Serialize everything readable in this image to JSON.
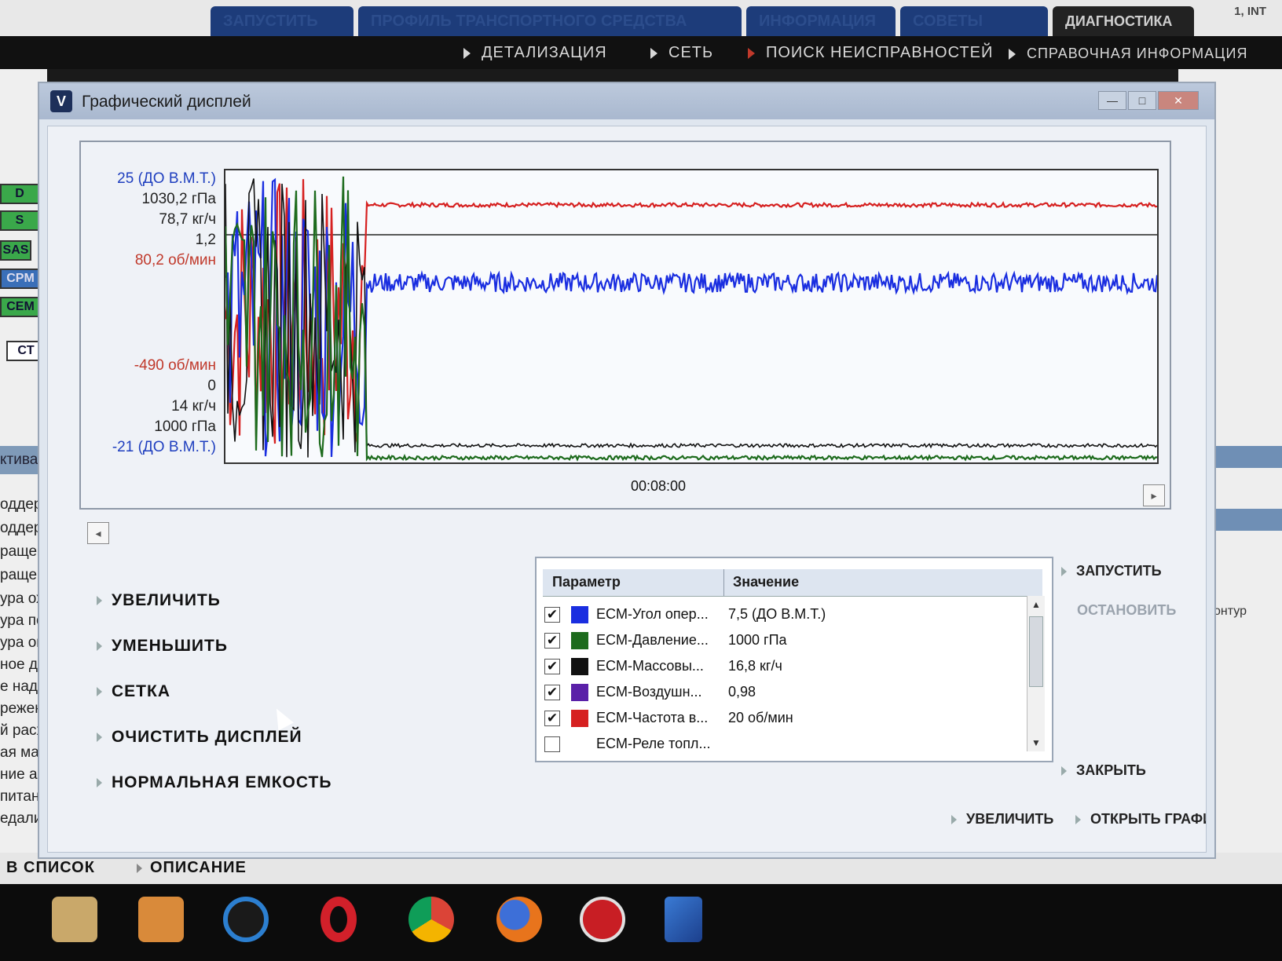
{
  "top_tabs": [
    {
      "label": "ЗАПУСТИТЬ"
    },
    {
      "label": "ПРОФИЛЬ ТРАНСПОРТНОГО СРЕДСТВА"
    },
    {
      "label": "ИНФОРМАЦИЯ"
    },
    {
      "label": "СОВЕТЫ"
    },
    {
      "label": "ДИАГНОСТИКА"
    }
  ],
  "top_corner": "1, INT",
  "subnav": [
    {
      "label": "ДЕТАЛИЗАЦИЯ"
    },
    {
      "label": "СЕТЬ"
    },
    {
      "label": "ПОИСК НЕИСПРАВНОСТЕЙ"
    },
    {
      "label": "СПРАВОЧНАЯ ИНФОРМАЦИЯ"
    }
  ],
  "background_left": {
    "nodes": [
      "D",
      "S",
      "SAS",
      "CPM",
      "CEM",
      "CT"
    ],
    "section_label": "ктива",
    "rows": [
      "оддер",
      "оддер",
      "ращен",
      "ращен",
      "ура ох",
      "ура по",
      "ура ок",
      "ное да",
      "е надд",
      "режен",
      "й расх",
      "ая мас",
      "ние ак",
      "питание",
      "едали"
    ]
  },
  "background_right": {
    "contour_label": "онтур"
  },
  "bottom_strip": {
    "list_label": "В СПИСОК",
    "description_label": "ОПИСАНИЕ",
    "enlarge_label": "УВЕЛИЧИТЬ",
    "open_graph_label": "ОТКРЫТЬ ГРАФИЧЕС"
  },
  "dialog": {
    "title": "Графический дисплей",
    "window_buttons": {
      "minimize": "—",
      "maximize": "□",
      "close": "✕"
    },
    "y_labels_top": [
      {
        "text": "25 (ДО В.М.Т.)",
        "color": "#1f3fbf"
      },
      {
        "text": "1030,2 гПа",
        "color": "#222222"
      },
      {
        "text": "78,7 кг/ч",
        "color": "#222222"
      },
      {
        "text": "1,2",
        "color": "#222222"
      },
      {
        "text": "80,2 об/мин",
        "color": "#c0392b"
      }
    ],
    "y_labels_bottom": [
      {
        "text": "-490 об/мин",
        "color": "#c0392b"
      },
      {
        "text": "0",
        "color": "#222222"
      },
      {
        "text": "14 кг/ч",
        "color": "#222222"
      },
      {
        "text": "1000 гПа",
        "color": "#222222"
      },
      {
        "text": "-21 (ДО В.М.Т.)",
        "color": "#1f3fbf"
      }
    ],
    "time_label": "00:08:00",
    "scroll_left": "◂",
    "scroll_right": "▸",
    "actions_left": [
      {
        "label": "УВЕЛИЧИТЬ"
      },
      {
        "label": "УМЕНЬШИТЬ"
      },
      {
        "label": "СЕТКА"
      },
      {
        "label": "ОЧИСТИТЬ ДИСПЛЕЙ"
      },
      {
        "label": "НОРМАЛЬНАЯ ЕМКОСТЬ"
      }
    ],
    "actions_right": {
      "start": "ЗАПУСТИТЬ",
      "stop": "ОСТАНОВИТЬ",
      "close": "ЗАКРЫТЬ"
    },
    "table": {
      "col_param": "Параметр",
      "col_value": "Значение",
      "rows": [
        {
          "checked": "✔",
          "color": "#1a2ee0",
          "name": "ECM-Угол опер...",
          "value": "7,5 (ДО В.М.Т.)"
        },
        {
          "checked": "✔",
          "color": "#1d6b1d",
          "name": "ECM-Давление...",
          "value": "1000 гПа"
        },
        {
          "checked": "✔",
          "color": "#111111",
          "name": "ECM-Массовы...",
          "value": "16,8 кг/ч"
        },
        {
          "checked": "✔",
          "color": "#5a20a8",
          "name": "ECM-Воздушн...",
          "value": "0,98"
        },
        {
          "checked": "✔",
          "color": "#d62020",
          "name": "ECM-Частота в...",
          "value": "20 об/мин"
        },
        {
          "checked": "",
          "color": "",
          "name": "ECM-Реле топл...",
          "value": ""
        }
      ]
    }
  },
  "colors": {
    "trace_red": "#d62020",
    "trace_blue": "#1a2ee0",
    "trace_black": "#111111",
    "trace_green": "#1d6b1d",
    "trace_purple": "#5a20a8"
  },
  "chart_data": {
    "type": "line",
    "xlabel": "00:08:00",
    "series": [
      {
        "name": "ECM-Частота в...",
        "color": "#d62020",
        "y_range": [
          -490,
          80.2
        ],
        "baseline": 20,
        "noise": 4
      },
      {
        "name": "ECM-Угол опер...",
        "color": "#1a2ee0",
        "y_range": [
          -21,
          25
        ],
        "baseline": 7.5,
        "noise": 1.6
      },
      {
        "name": "ECM-Массовы...",
        "color": "#111111",
        "y_range": [
          14,
          78.7
        ],
        "baseline": 16.8,
        "noise": 0.4
      },
      {
        "name": "ECM-Давление...",
        "color": "#1d6b1d",
        "y_range": [
          1000,
          1030.2
        ],
        "baseline": 1000,
        "noise": 0.2
      }
    ]
  }
}
